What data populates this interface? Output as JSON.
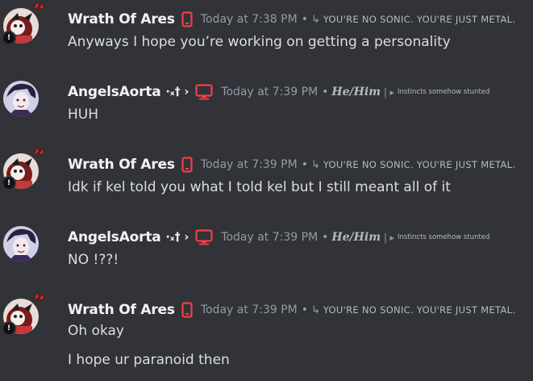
{
  "messages": [
    {
      "author": "Wrath Of Ares",
      "author_type": "wrath",
      "time": "Today at 7:38 PM",
      "tag": "YOU'RE NO SONIC. YOU'RE JUST METAL.",
      "tag_arrow": "↳",
      "device_icon": "phone-icon",
      "lines": [
        "Anyways I hope you’re working on getting a personality"
      ]
    },
    {
      "author": "AngelsAorta",
      "author_deco": "·ₓ† ›",
      "author_type": "angel",
      "time": "Today at 7:39 PM",
      "pronouns": "He/Him",
      "pron_sep": "⸾ ▸",
      "tag": "Instincts somehow stunted",
      "device_icon": "monitor-icon",
      "lines": [
        "HUH"
      ]
    },
    {
      "author": "Wrath Of Ares",
      "author_type": "wrath",
      "time": "Today at 7:39 PM",
      "tag": "YOU'RE NO SONIC. YOU'RE JUST METAL.",
      "tag_arrow": "↳",
      "device_icon": "phone-icon",
      "lines": [
        "Idk if kel told you what I told kel but I still meant all of it"
      ]
    },
    {
      "author": "AngelsAorta",
      "author_deco": "·ₓ† ›",
      "author_type": "angel",
      "time": "Today at 7:39 PM",
      "pronouns": "He/Him",
      "pron_sep": "⸾ ▸",
      "tag": "Instincts somehow stunted",
      "device_icon": "monitor-icon",
      "lines": [
        "NO !??!"
      ]
    },
    {
      "author": "Wrath Of Ares",
      "author_type": "wrath",
      "time": "Today at 7:39 PM",
      "tag": "YOU'RE NO SONIC. YOU'RE JUST METAL.",
      "tag_arrow": "↳",
      "device_icon": "phone-icon",
      "lines": [
        "Oh okay",
        "I hope ur paranoid then"
      ]
    }
  ],
  "separator": "•",
  "colors": {
    "background": "#313338",
    "username": "#f2f3f5",
    "timestamp": "#949ba4",
    "message_text": "#dbdee1",
    "device_icon": "#f23f43"
  }
}
